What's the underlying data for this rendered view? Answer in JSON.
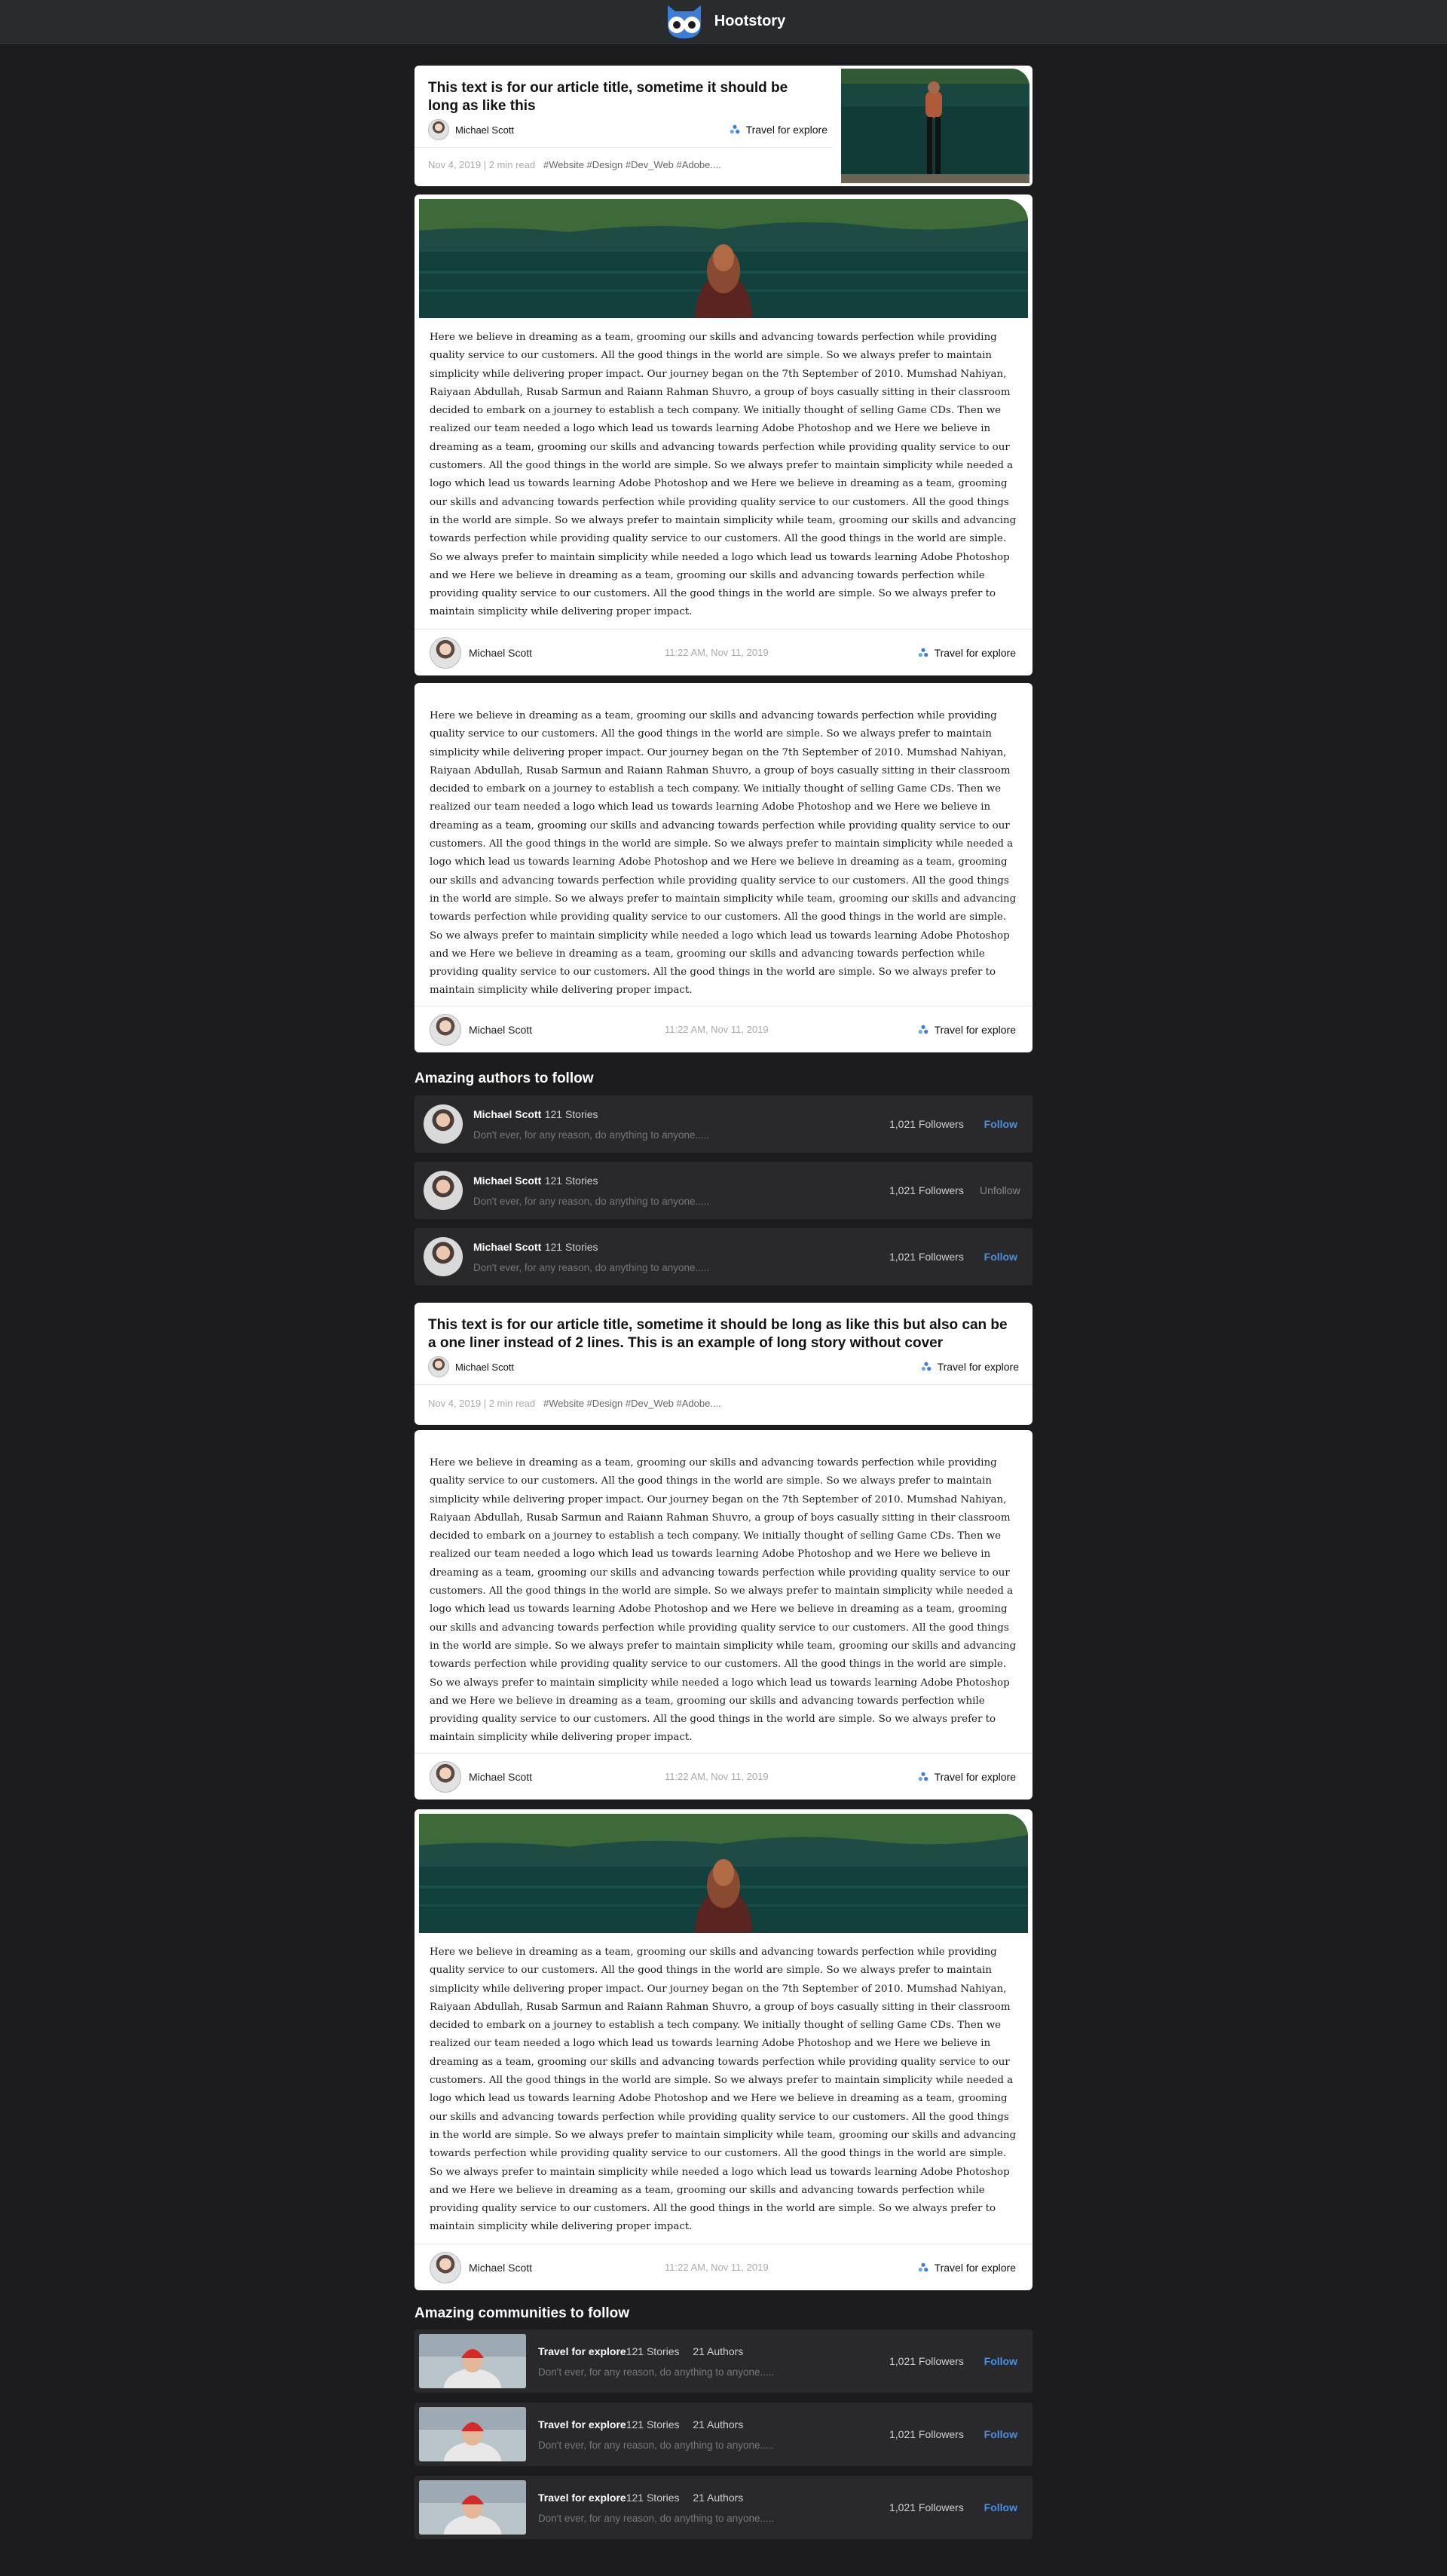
{
  "header": {
    "brand": "Hootstory"
  },
  "colors": {
    "bg": "#1c1c1e",
    "accent": "#4a90e2",
    "card": "#ffffff"
  },
  "story_card_1": {
    "title": "This text is for our article title, sometime it should be long as like this",
    "author": "Michael Scott",
    "community": "Travel for explore",
    "meta": "Nov 4, 2019 | 2 min read",
    "tags": "#Website #Design #Dev_Web #Adobe....",
    "has_thumbnail": true
  },
  "post_1": {
    "body": "Here we believe in dreaming as a team, grooming our skills and advancing towards perfection while providing quality service to our customers. All the good things in the world are simple. So we always prefer to maintain simplicity while delivering proper impact. Our journey began on the 7th September of 2010. Mumshad Nahiyan, Raiyaan Abdullah, Rusab Sarmun and Raiann Rahman Shuvro, a group of boys casually sitting in their classroom decided to embark on a journey to establish a tech company. We initially thought of selling Game CDs. Then we realized our team needed a logo which lead us towards learning Adobe Photoshop and we Here we believe in dreaming as a team, grooming our skills and advancing towards perfection while providing quality service to our customers. All the good things in the world are simple. So we always prefer to maintain simplicity while needed a logo which lead us towards learning Adobe Photoshop and we Here we believe in dreaming as a team, grooming our skills and advancing towards perfection while providing quality service to our customers. All the good things in the world are simple. So we always prefer to maintain simplicity while team, grooming our skills and advancing towards perfection while providing quality service to our customers. All the good things in the world are simple. So we always prefer to maintain simplicity while needed a logo which lead us towards learning Adobe Photoshop and we Here we believe in dreaming as a team, grooming our skills and advancing towards perfection while providing quality service to our customers. All the good things in the world are simple. So we always prefer to maintain simplicity while delivering proper impact.",
    "author": "Michael Scott",
    "time": "11:22 AM, Nov 11, 2019",
    "community": "Travel for explore"
  },
  "post_2": {
    "body": "Here we believe in dreaming as a team, grooming our skills and advancing towards perfection while providing quality service to our customers. All the good things in the world are simple. So we always prefer to maintain simplicity while delivering proper impact. Our journey began on the 7th September of 2010. Mumshad Nahiyan, Raiyaan Abdullah, Rusab Sarmun and Raiann Rahman Shuvro, a group of boys casually sitting in their classroom decided to embark on a journey to establish a tech company. We initially thought of selling Game CDs. Then we realized our team needed a logo which lead us towards learning Adobe Photoshop and we Here we believe in dreaming as a team, grooming our skills and advancing towards perfection while providing quality service to our customers. All the good things in the world are simple. So we always prefer to maintain simplicity while needed a logo which lead us towards learning Adobe Photoshop and we Here we believe in dreaming as a team, grooming our skills and advancing towards perfection while providing quality service to our customers. All the good things in the world are simple. So we always prefer to maintain simplicity while team, grooming our skills and advancing towards perfection while providing quality service to our customers. All the good things in the world are simple. So we always prefer to maintain simplicity while needed a logo which lead us towards learning Adobe Photoshop and we Here we believe in dreaming as a team, grooming our skills and advancing towards perfection while providing quality service to our customers. All the good things in the world are simple. So we always prefer to maintain simplicity while delivering proper impact.",
    "author": "Michael Scott",
    "time": "11:22 AM, Nov 11, 2019",
    "community": "Travel for explore"
  },
  "authors_section": {
    "heading": "Amazing authors to follow",
    "items": [
      {
        "name": "Michael Scott",
        "stories": "121 Stories",
        "desc": "Don't ever, for any reason, do anything to anyone.....",
        "followers": "1,021 Followers",
        "action": "Follow"
      },
      {
        "name": "Michael Scott",
        "stories": "121 Stories",
        "desc": "Don't ever, for any reason, do anything to anyone.....",
        "followers": "1,021 Followers",
        "action": "Unfollow"
      },
      {
        "name": "Michael Scott",
        "stories": "121 Stories",
        "desc": "Don't ever, for any reason, do anything to anyone.....",
        "followers": "1,021 Followers",
        "action": "Follow"
      }
    ]
  },
  "story_card_2": {
    "title": "This text is for our article title, sometime it should be long as like this but also can be a one liner instead of 2 lines. This is an example of long story without cover",
    "author": "Michael Scott",
    "community": "Travel for explore",
    "meta": "Nov 4, 2019 | 2 min read",
    "tags": "#Website #Design #Dev_Web #Adobe...."
  },
  "post_3": {
    "body": "Here we believe in dreaming as a team, grooming our skills and advancing towards perfection while providing quality service to our customers. All the good things in the world are simple. So we always prefer to maintain simplicity while delivering proper impact. Our journey began on the 7th September of 2010. Mumshad Nahiyan, Raiyaan Abdullah, Rusab Sarmun and Raiann Rahman Shuvro, a group of boys casually sitting in their classroom decided to embark on a journey to establish a tech company. We initially thought of selling Game CDs. Then we realized our team needed a logo which lead us towards learning Adobe Photoshop and we Here we believe in dreaming as a team, grooming our skills and advancing towards perfection while providing quality service to our customers. All the good things in the world are simple. So we always prefer to maintain simplicity while needed a logo which lead us towards learning Adobe Photoshop and we Here we believe in dreaming as a team, grooming our skills and advancing towards perfection while providing quality service to our customers. All the good things in the world are simple. So we always prefer to maintain simplicity while team, grooming our skills and advancing towards perfection while providing quality service to our customers. All the good things in the world are simple. So we always prefer to maintain simplicity while needed a logo which lead us towards learning Adobe Photoshop and we Here we believe in dreaming as a team, grooming our skills and advancing towards perfection while providing quality service to our customers. All the good things in the world are simple. So we always prefer to maintain simplicity while delivering proper impact.",
    "author": "Michael Scott",
    "time": "11:22 AM, Nov 11, 2019",
    "community": "Travel for explore"
  },
  "post_4": {
    "body": "Here we believe in dreaming as a team, grooming our skills and advancing towards perfection while providing quality service to our customers. All the good things in the world are simple. So we always prefer to maintain simplicity while delivering proper impact. Our journey began on the 7th September of 2010. Mumshad Nahiyan, Raiyaan Abdullah, Rusab Sarmun and Raiann Rahman Shuvro, a group of boys casually sitting in their classroom decided to embark on a journey to establish a tech company. We initially thought of selling Game CDs. Then we realized our team needed a logo which lead us towards learning Adobe Photoshop and we Here we believe in dreaming as a team, grooming our skills and advancing towards perfection while providing quality service to our customers. All the good things in the world are simple. So we always prefer to maintain simplicity while needed a logo which lead us towards learning Adobe Photoshop and we Here we believe in dreaming as a team, grooming our skills and advancing towards perfection while providing quality service to our customers. All the good things in the world are simple. So we always prefer to maintain simplicity while team, grooming our skills and advancing towards perfection while providing quality service to our customers. All the good things in the world are simple. So we always prefer to maintain simplicity while needed a logo which lead us towards learning Adobe Photoshop and we Here we believe in dreaming as a team, grooming our skills and advancing towards perfection while providing quality service to our customers. All the good things in the world are simple. So we always prefer to maintain simplicity while delivering proper impact.",
    "author": "Michael Scott",
    "time": "11:22 AM, Nov 11, 2019",
    "community": "Travel for explore"
  },
  "communities_section": {
    "heading": "Amazing communities to follow",
    "items": [
      {
        "name": "Travel for explore",
        "stories": "121 Stories",
        "authors": "21 Authors",
        "desc": "Don't ever, for any reason, do anything to anyone.....",
        "followers": "1,021 Followers",
        "action": "Follow"
      },
      {
        "name": "Travel for explore",
        "stories": "121 Stories",
        "authors": "21 Authors",
        "desc": "Don't ever, for any reason, do anything to anyone.....",
        "followers": "1,021 Followers",
        "action": "Follow"
      },
      {
        "name": "Travel for explore",
        "stories": "121 Stories",
        "authors": "21 Authors",
        "desc": "Don't ever, for any reason, do anything to anyone.....",
        "followers": "1,021 Followers",
        "action": "Follow"
      }
    ]
  }
}
